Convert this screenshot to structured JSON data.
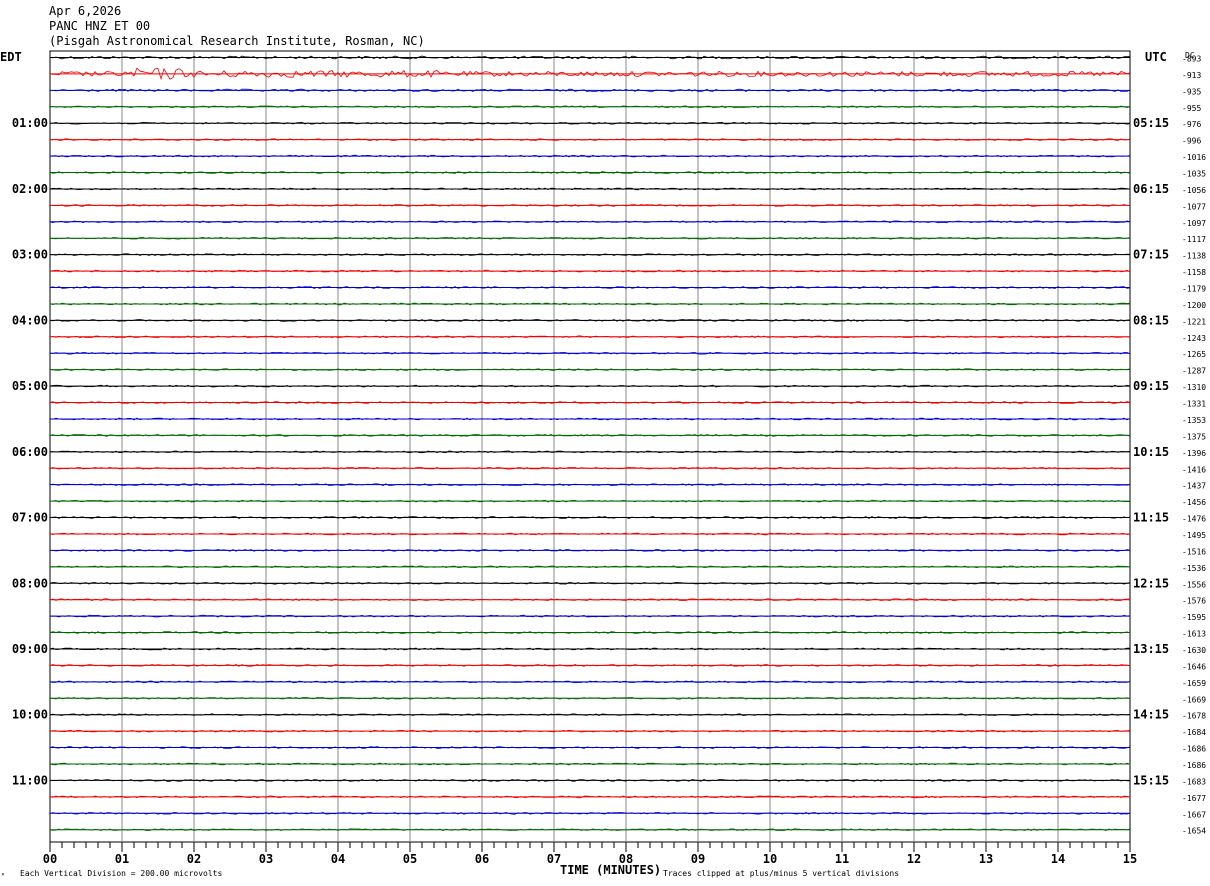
{
  "header": {
    "date": "Apr 6,2026",
    "station": "PANC HNZ ET 00",
    "location": "(Pisgah Astronomical Research Institute, Rosman, NC)"
  },
  "chart_data": {
    "type": "line",
    "title": "",
    "xlabel": "TIME (MINUTES)",
    "xlim": [
      0,
      15
    ],
    "x_ticks": [
      "00",
      "01",
      "02",
      "03",
      "04",
      "05",
      "06",
      "07",
      "08",
      "09",
      "10",
      "11",
      "12",
      "13",
      "14",
      "15"
    ],
    "left_axis_label": "EDT",
    "right_axis_label": "UTC",
    "dc_label": "DC",
    "left_hour_labels": [
      "01:00",
      "02:00",
      "03:00",
      "04:00",
      "05:00",
      "06:00",
      "07:00",
      "08:00",
      "09:00",
      "10:00",
      "11:00"
    ],
    "right_hour_labels": [
      "05:15",
      "06:15",
      "07:15",
      "08:15",
      "09:15",
      "10:15",
      "11:15",
      "12:15",
      "13:15",
      "14:15",
      "15:15"
    ],
    "dc_offsets": [
      "-893",
      "-913",
      "-935",
      "-955",
      "-976",
      "-996",
      "-1016",
      "-1035",
      "-1056",
      "-1077",
      "-1097",
      "-1117",
      "-1138",
      "-1158",
      "-1179",
      "-1200",
      "-1221",
      "-1243",
      "-1265",
      "-1287",
      "-1310",
      "-1331",
      "-1353",
      "-1375",
      "-1396",
      "-1416",
      "-1437",
      "-1456",
      "-1476",
      "-1495",
      "-1516",
      "-1536",
      "-1556",
      "-1576",
      "-1595",
      "-1613",
      "-1630",
      "-1646",
      "-1659",
      "-1669",
      "-1678",
      "-1684",
      "-1686",
      "-1686",
      "-1683",
      "-1677",
      "-1667",
      "-1654"
    ],
    "trace_colors": [
      "#000000",
      "#ee0000",
      "#0000cc",
      "#006600"
    ],
    "trace_count": 48,
    "footer_left": "Each Vertical Division =  200.00 microvolts",
    "footer_right": "Traces clipped at plus/minus 5 vertical divisions",
    "grid": true
  }
}
